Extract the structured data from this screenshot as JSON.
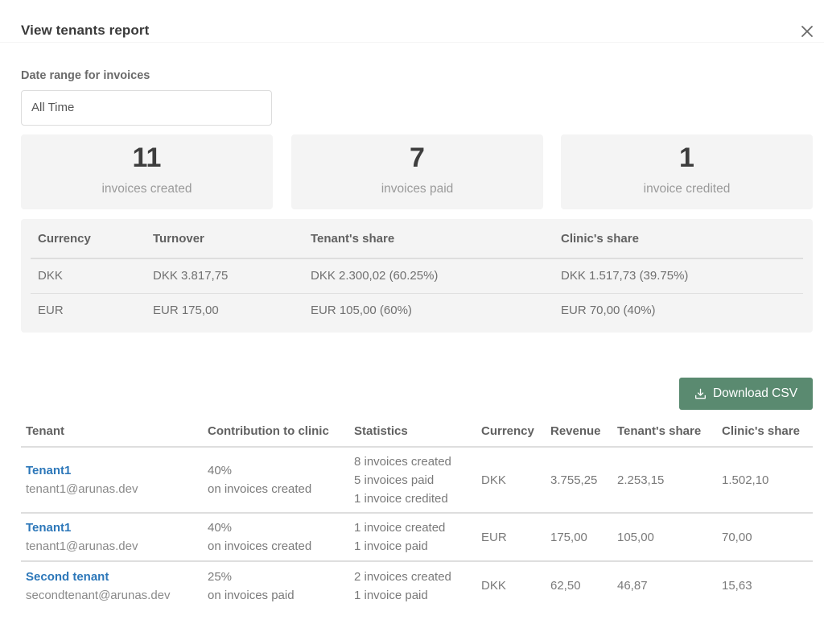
{
  "header": {
    "title": "View tenants report",
    "close_icon": "close-icon"
  },
  "date_range": {
    "label": "Date range for invoices",
    "value": "All Time"
  },
  "stats": [
    {
      "value": "11",
      "label": "invoices created"
    },
    {
      "value": "7",
      "label": "invoices paid"
    },
    {
      "value": "1",
      "label": "invoice credited"
    }
  ],
  "summary": {
    "columns": [
      "Currency",
      "Turnover",
      "Tenant's share",
      "Clinic's share"
    ],
    "rows": [
      {
        "currency": "DKK",
        "turnover": "DKK 3.817,75",
        "tenant_share": "DKK 2.300,02 (60.25%)",
        "clinic_share": "DKK 1.517,73 (39.75%)"
      },
      {
        "currency": "EUR",
        "turnover": "EUR 175,00",
        "tenant_share": "EUR 105,00 (60%)",
        "clinic_share": "EUR 70,00 (40%)"
      }
    ]
  },
  "download": {
    "label": "Download CSV",
    "icon": "download-icon",
    "color": "#5a8a70"
  },
  "tenants": {
    "columns": [
      "Tenant",
      "Contribution to clinic",
      "Statistics",
      "Currency",
      "Revenue",
      "Tenant's share",
      "Clinic's share"
    ],
    "rows": [
      {
        "name": "Tenant1",
        "email": "tenant1@arunas.dev",
        "contribution_pct": "40%",
        "contribution_basis": "on invoices created",
        "statistics": [
          "8 invoices created",
          "5 invoices paid",
          "1 invoice credited"
        ],
        "currency": "DKK",
        "revenue": "3.755,25",
        "tenant_share": "2.253,15",
        "clinic_share": "1.502,10"
      },
      {
        "name": "Tenant1",
        "email": "tenant1@arunas.dev",
        "contribution_pct": "40%",
        "contribution_basis": "on invoices created",
        "statistics": [
          "1 invoice created",
          "1 invoice paid"
        ],
        "currency": "EUR",
        "revenue": "175,00",
        "tenant_share": "105,00",
        "clinic_share": "70,00"
      },
      {
        "name": "Second tenant",
        "email": "secondtenant@arunas.dev",
        "contribution_pct": "25%",
        "contribution_basis": "on invoices paid",
        "statistics": [
          "2 invoices created",
          "1 invoice paid"
        ],
        "currency": "DKK",
        "revenue": "62,50",
        "tenant_share": "46,87",
        "clinic_share": "15,63"
      }
    ]
  },
  "colors": {
    "link": "#2c77b9",
    "card_bg": "#f4f4f4",
    "accent_button": "#5a8a70"
  }
}
